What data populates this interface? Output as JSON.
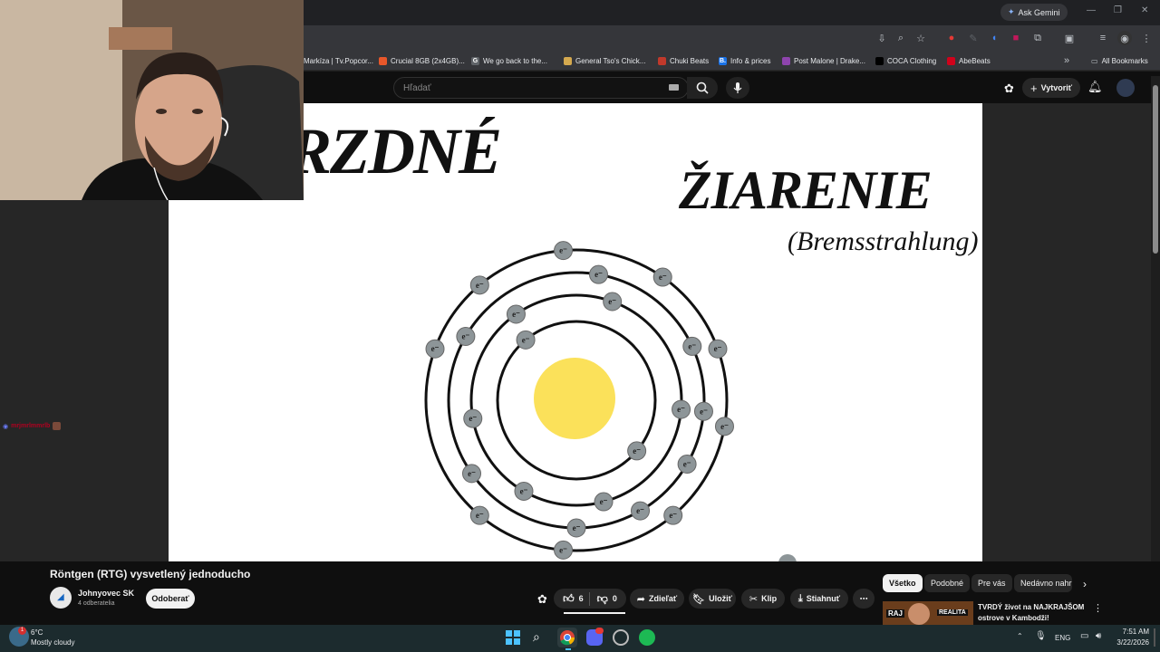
{
  "browser": {
    "ask_gemini": "Ask Gemini",
    "bookmarks": [
      {
        "label": "Markíza | Tv.Popcor...",
        "color": "#c0392b",
        "glyph": ""
      },
      {
        "label": "Crucial 8GB (2x4GB)...",
        "color": "#e8572a",
        "glyph": ""
      },
      {
        "label": "We go back to the...",
        "color": "#5f6368",
        "glyph": "G"
      },
      {
        "label": "General Tso's Chick...",
        "color": "#d4a94f",
        "glyph": ""
      },
      {
        "label": "Chuki Beats",
        "color": "#c0392b",
        "glyph": ""
      },
      {
        "label": "Info & prices",
        "color": "#1a73e8",
        "glyph": "B."
      },
      {
        "label": "Post Malone | Drake...",
        "color": "#8e44ad",
        "glyph": ""
      },
      {
        "label": "COCA Clothing",
        "color": "#000000",
        "glyph": ""
      },
      {
        "label": "AbeBeats",
        "color": "#d0021b",
        "glyph": ""
      }
    ],
    "all_bookmarks": "All Bookmarks"
  },
  "youtube": {
    "search_placeholder": "Hľadať",
    "create_label": "Vytvoriť"
  },
  "slide": {
    "left_word": "RZDNÉ",
    "right_word": "ŽIARENIE",
    "subtitle": "(Bremsstrahlung)",
    "electron_label": "e⁻"
  },
  "chat_overlay": {
    "user": "mrjmrlmmrlb"
  },
  "video": {
    "title": "Röntgen (RTG) vysvetlený jednoducho",
    "channel": "Johnyovec SK",
    "subscribers": "4 odberatelia",
    "subscribe_label": "Odoberať",
    "likes": "6",
    "dislikes": "0",
    "share_label": "Zdieľať",
    "save_label": "Uložiť",
    "clip_label": "Klip",
    "download_label": "Stiahnuť"
  },
  "chips": [
    "Všetko",
    "Podobné",
    "Pre vás",
    "Nedávno nahr"
  ],
  "recommendation": {
    "title_line1": "TVRDÝ život na NAJKRAJŠOM",
    "title_line2": "ostrove v Kambodži!",
    "thumb_left": "RAJ",
    "thumb_right": "REALITA"
  },
  "taskbar": {
    "weather_temp": "6°C",
    "weather_desc": "Mostly cloudy",
    "weather_badge": "1",
    "lang": "ENG",
    "time": "7:51 AM",
    "date": "3/22/2026"
  },
  "colors": {
    "accent_red": "#ff0000",
    "sun": "#fbe15a",
    "electron": "#8d9598"
  }
}
